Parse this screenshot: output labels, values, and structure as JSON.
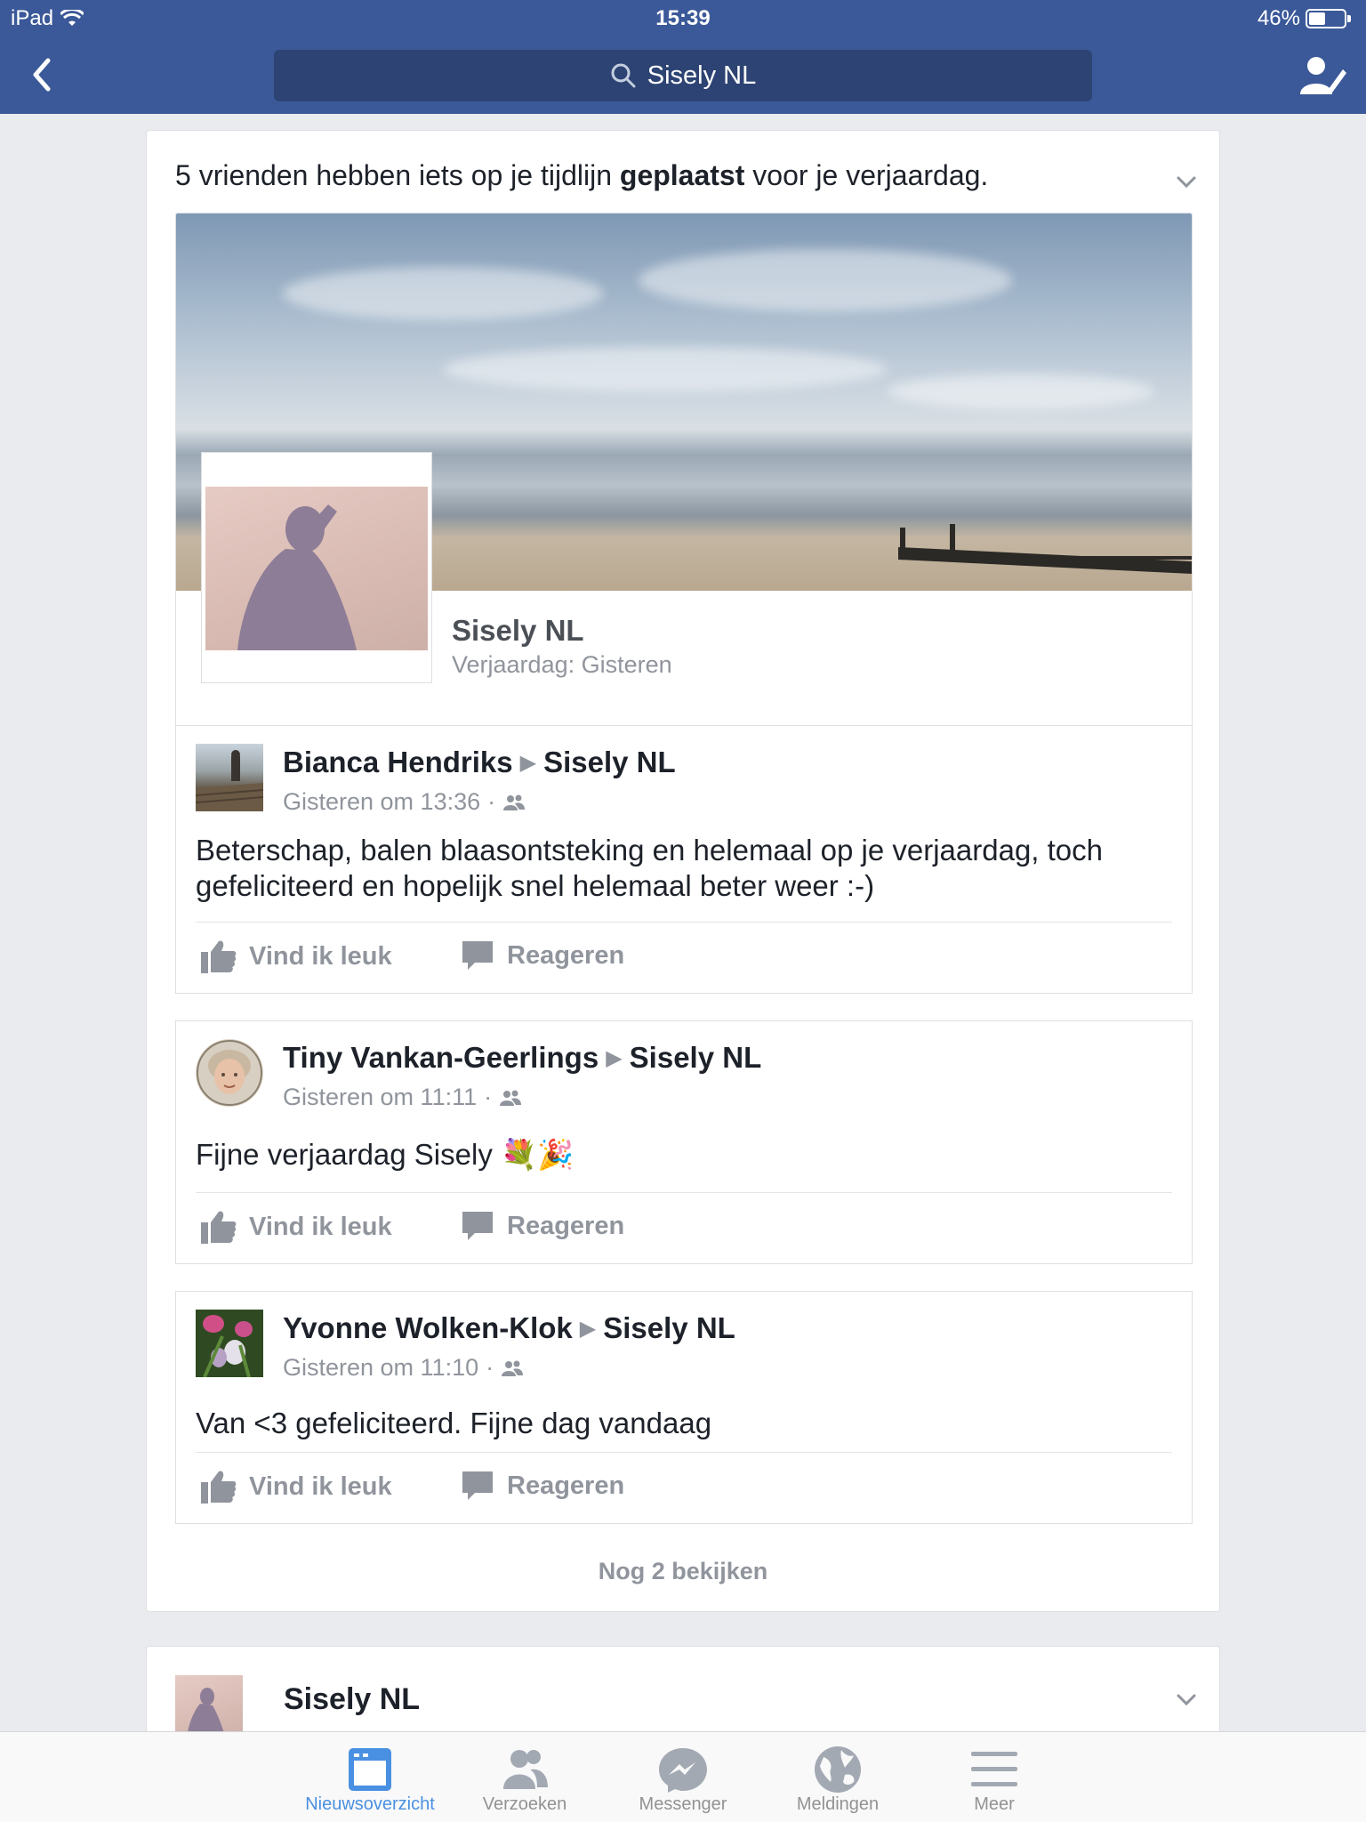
{
  "status_bar": {
    "device": "iPad",
    "time": "15:39",
    "battery": "46%",
    "battery_level": 0.46
  },
  "header": {
    "search_label": "Sisely NL"
  },
  "birthday_card": {
    "header_prefix": "5 vrienden hebben iets op je tijdlijn ",
    "header_bold": "geplaatst",
    "header_suffix": " voor je verjaardag.",
    "profile_name": "Sisely NL",
    "profile_sub": "Verjaardag: Gisteren",
    "posts": [
      {
        "author": "Bianca Hendriks",
        "target": "Sisely NL",
        "time": "Gisteren om 13:36",
        "text": "Beterschap, balen blaasontsteking en helemaal op je verjaardag, toch gefeliciteerd en hopelijk snel helemaal beter weer :-)",
        "like": "Vind ik leuk",
        "comment": "Reageren"
      },
      {
        "author": "Tiny Vankan-Geerlings",
        "target": "Sisely NL",
        "time": "Gisteren om 11:11",
        "text": "Fijne verjaardag Sisely 💐🎉",
        "like": "Vind ik leuk",
        "comment": "Reageren"
      },
      {
        "author": "Yvonne Wolken-Klok",
        "target": "Sisely NL",
        "time": "Gisteren om 11:10",
        "text": "Van <3 gefeliciteerd. Fijne dag vandaag",
        "like": "Vind ik leuk",
        "comment": "Reageren"
      }
    ],
    "more_label": "Nog 2 bekijken"
  },
  "next_card": {
    "name": "Sisely NL"
  },
  "tabbar": {
    "tabs": [
      {
        "label": "Nieuwsoverzicht",
        "icon": "news-feed-icon",
        "active": true
      },
      {
        "label": "Verzoeken",
        "icon": "friends-icon",
        "active": false
      },
      {
        "label": "Messenger",
        "icon": "messenger-icon",
        "active": false
      },
      {
        "label": "Meldingen",
        "icon": "globe-icon",
        "active": false
      },
      {
        "label": "Meer",
        "icon": "menu-icon",
        "active": false
      }
    ]
  },
  "colors": {
    "brand": "#3b5998",
    "active_tab": "#4a90e2",
    "muted": "#90949c"
  }
}
